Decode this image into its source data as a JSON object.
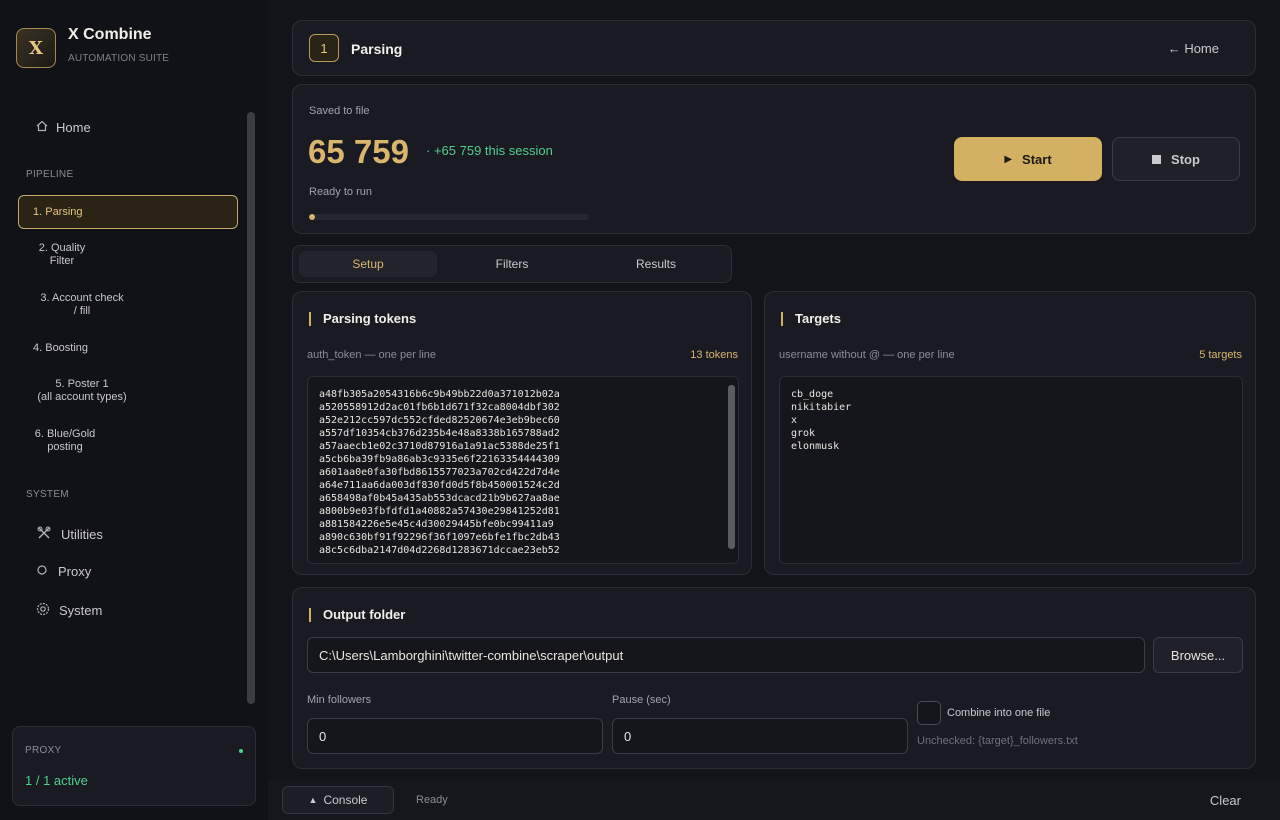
{
  "app": {
    "title": "X Combine",
    "subtitle": "AUTOMATION SUITE",
    "logo_letter": "X"
  },
  "sidebar": {
    "home": {
      "label": "Home",
      "icon": "home-icon"
    },
    "pipeline_label": "PIPELINE",
    "steps": [
      {
        "label": "1. Parsing",
        "active": true
      },
      {
        "label": "2. Quality\nFilter",
        "active": false
      },
      {
        "label": "3. Account check\n/ fill",
        "active": false
      },
      {
        "label": "4. Boosting",
        "active": false
      },
      {
        "label": "5. Poster 1\n(all account types)",
        "active": false
      },
      {
        "label": "6. Blue/Gold\nposting",
        "active": false
      }
    ],
    "system_label": "SYSTEM",
    "system_items": [
      {
        "label": "Utilities",
        "icon": "tools-icon"
      },
      {
        "label": "Proxy",
        "icon": "circle-icon"
      },
      {
        "label": "System",
        "icon": "gear-icon"
      }
    ],
    "proxy": {
      "label": "PROXY",
      "value": "1 / 1 active",
      "status_color": "#4fcf8d"
    }
  },
  "header": {
    "step_number": "1",
    "title": "Parsing",
    "home_link": "← Home"
  },
  "stats": {
    "saved_label": "Saved to file",
    "count": "65 759",
    "session": "· +65 759 this session",
    "status": "Ready to run",
    "progress": 0.02,
    "start_label": "Start",
    "stop_label": "Stop"
  },
  "tabs": [
    {
      "label": "Setup",
      "active": true
    },
    {
      "label": "Filters",
      "active": false
    },
    {
      "label": "Results",
      "active": false
    }
  ],
  "tokens": {
    "title": "Parsing tokens",
    "hint": "auth_token — one per line",
    "count": "13 tokens",
    "text": "a48fb305a2054316b6c9b49bb22d0a371012b02a\na520558912d2ac01fb6b1d671f32ca8004dbf302\na52e212cc597dc552cfded82520674e3eb9bec60\na557df10354cb376d235b4e48a8338b165788ad2\na57aaecb1e02c3710d87916a1a91ac5388de25f1\na5cb6ba39fb9a86ab3c9335e6f22163354444309\na601aa0e0fa30fbd8615577023a702cd422d7d4e\na64e711aa6da003df830fd0d5f8b450001524c2d\na658498af0b45a435ab553dcacd21b9b627aa8ae\na800b9e03fbfdfd1a40882a57430e29841252d81\na881584226e5e45c4d30029445bfe0bc99411a9\na890c630bf91f92296f36f1097e6bfe1fbc2db43\na8c5c6dba2147d04d2268d1283671dccae23eb52"
  },
  "targets": {
    "title": "Targets",
    "hint": "username without @ — one per line",
    "count": "5 targets",
    "text": "cb_doge\nnikitabier\nx\ngrok\nelonmusk"
  },
  "output": {
    "title": "Output folder",
    "path": "C:\\Users\\Lamborghini\\twitter-combine\\scraper\\output",
    "browse_label": "Browse...",
    "min_followers_label": "Min followers",
    "min_followers_value": "0",
    "pause_label": "Pause (sec)",
    "pause_value": "0",
    "combine_label": "Combine into one file",
    "combine_checked": false,
    "unchecked_hint": "Unchecked: {target}_followers.txt"
  },
  "bottom": {
    "console_label": "Console",
    "status": "Ready",
    "clear_label": "Clear"
  }
}
